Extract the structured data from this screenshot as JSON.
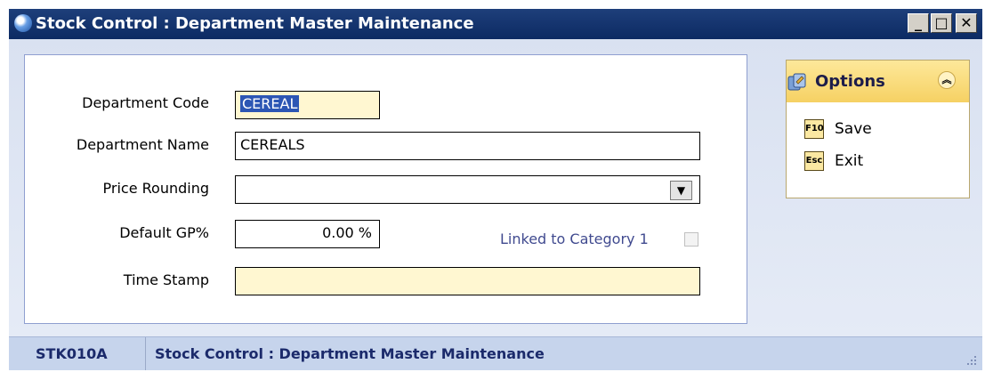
{
  "window": {
    "title": "Stock Control : Department Master Maintenance",
    "controls": {
      "minimize": "_",
      "maximize": "□",
      "close": "✕"
    }
  },
  "form": {
    "department_code": {
      "label": "Department Code",
      "value": "CEREAL"
    },
    "department_name": {
      "label": "Department Name",
      "value": "CEREALS"
    },
    "price_rounding": {
      "label": "Price Rounding",
      "value": ""
    },
    "default_gp": {
      "label": "Default GP%",
      "value": "0.00 %"
    },
    "linked_category": {
      "label": "Linked to Category 1",
      "checked": false
    },
    "time_stamp": {
      "label": "Time Stamp",
      "value": ""
    }
  },
  "options": {
    "title": "Options",
    "items": [
      {
        "key": "F10",
        "label": "Save"
      },
      {
        "key": "Esc",
        "label": "Exit"
      }
    ]
  },
  "statusbar": {
    "code": "STK010A",
    "title": "Stock Control : Department Master Maintenance"
  },
  "colors": {
    "titlebar": "#0c2a63",
    "client_bg": "#dfe6f4",
    "yellow_field": "#fff7d1",
    "options_header": "#f6d163",
    "status_text": "#1b2a6b"
  }
}
